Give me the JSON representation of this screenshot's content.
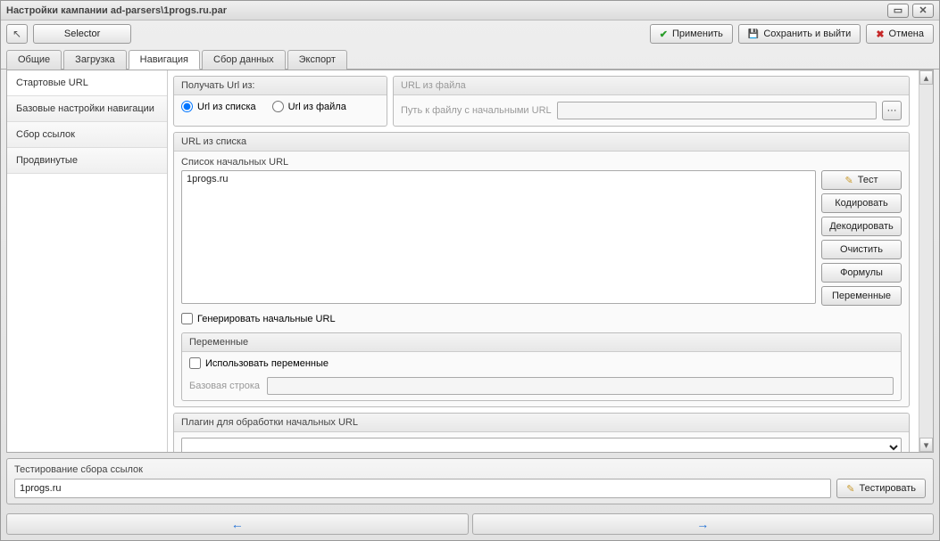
{
  "window": {
    "title": "Настройки кампании ad-parsers\\1progs.ru.par"
  },
  "toolbar": {
    "selector": "Selector",
    "apply": "Применить",
    "save_exit": "Сохранить и выйти",
    "cancel": "Отмена"
  },
  "tabs": [
    "Общие",
    "Загрузка",
    "Навигация",
    "Сбор данных",
    "Экспорт"
  ],
  "active_tab_index": 2,
  "sidebar": {
    "items": [
      "Стартовые URL",
      "Базовые настройки навигации",
      "Сбор ссылок",
      "Продвинутые"
    ],
    "selected_index": 0
  },
  "get_url_from": {
    "title": "Получать Url из:",
    "opt_list": "Url из списка",
    "opt_file": "Url из файла",
    "selected": "list"
  },
  "url_from_file": {
    "title": "URL из файла",
    "label": "Путь к файлу с начальными URL",
    "value": ""
  },
  "url_list": {
    "title": "URL из списка",
    "label": "Список начальных URL",
    "value": "1progs.ru",
    "buttons": {
      "test": "Тест",
      "encode": "Кодировать",
      "decode": "Декодировать",
      "clear": "Очистить",
      "formulas": "Формулы",
      "variables": "Переменные"
    },
    "generate": "Генерировать начальные URL"
  },
  "variables": {
    "title": "Переменные",
    "use": "Использовать переменные",
    "base_label": "Базовая строка",
    "base_value": ""
  },
  "plugin": {
    "title": "Плагин для обработки начальных URL",
    "value": ""
  },
  "test_section": {
    "title": "Тестирование сбора ссылок",
    "value": "1progs.ru",
    "button": "Тестировать"
  }
}
